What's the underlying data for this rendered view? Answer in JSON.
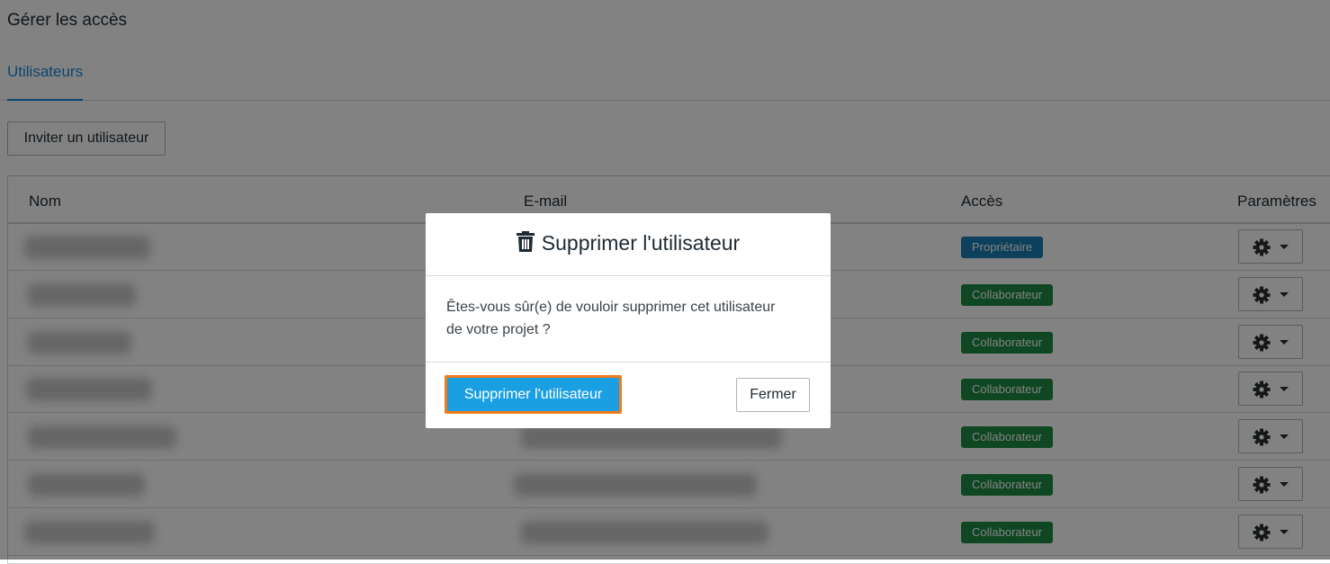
{
  "page": {
    "title": "Gérer les accès"
  },
  "tabs": [
    {
      "label": "Utilisateurs",
      "active": true
    }
  ],
  "toolbar": {
    "invite_label": "Inviter un utilisateur"
  },
  "table": {
    "headers": {
      "name": "Nom",
      "email": "E-mail",
      "access": "Accès",
      "settings": "Paramètres"
    },
    "rows": [
      {
        "access": "Propriétaire",
        "access_color": "#1b7fb5"
      },
      {
        "access": "Collaborateur",
        "access_color": "#1e8c45"
      },
      {
        "access": "Collaborateur",
        "access_color": "#1e8c45"
      },
      {
        "access": "Collaborateur",
        "access_color": "#1e8c45"
      },
      {
        "access": "Collaborateur",
        "access_color": "#1e8c45"
      },
      {
        "access": "Collaborateur",
        "access_color": "#1e8c45"
      },
      {
        "access": "Collaborateur",
        "access_color": "#1e8c45"
      }
    ]
  },
  "modal": {
    "title": "Supprimer l'utilisateur",
    "title_icon": "trash-icon",
    "message": "Êtes-vous sûr(e) de vouloir supprimer cet utilisateur de votre projet ?",
    "confirm_label": "Supprimer l'utilisateur",
    "close_label": "Fermer"
  },
  "colors": {
    "accent": "#1b8ad8",
    "confirm_button": "#1aa0e2",
    "highlight_outline": "#f07c1b",
    "owner_badge": "#1b7fb5",
    "collaborator_badge": "#1e8c45",
    "overlay": "rgba(0,0,0,0.49)"
  }
}
